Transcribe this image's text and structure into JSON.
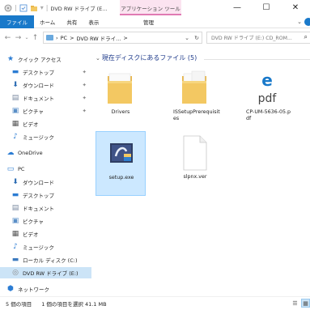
{
  "window": {
    "title": "DVD RW ドライブ (E...",
    "context_tab_group": "アプリケーション ツール",
    "controls": {
      "minimize": "—",
      "maximize": "☐",
      "close": "✕"
    }
  },
  "ribbon": {
    "tabs": [
      "ファイル",
      "ホーム",
      "共有",
      "表示"
    ],
    "context_tab": "管理"
  },
  "address": {
    "back": "←",
    "forward": "→",
    "dropdown": "⌄",
    "up": "↑",
    "segments": [
      "PC",
      ">",
      "DVD RW ドライ...",
      ">"
    ],
    "refresh": "↻",
    "search_placeholder": "DVD RW ドライブ (E:) CD_ROM...",
    "search_icon": "⌕"
  },
  "sidebar": {
    "items": [
      {
        "label": "クイック アクセス",
        "icon": "star-icon",
        "pinned": false
      },
      {
        "label": "デスクトップ",
        "icon": "desktop-icon",
        "pinned": true
      },
      {
        "label": "ダウンロード",
        "icon": "download-icon",
        "pinned": true
      },
      {
        "label": "ドキュメント",
        "icon": "documents-icon",
        "pinned": true
      },
      {
        "label": "ピクチャ",
        "icon": "pictures-icon",
        "pinned": true
      },
      {
        "label": "ビデオ",
        "icon": "videos-icon",
        "pinned": false
      },
      {
        "label": "ミュージック",
        "icon": "music-icon",
        "pinned": false
      },
      {
        "label": "OneDrive",
        "icon": "onedrive-icon",
        "pinned": false
      },
      {
        "label": "PC",
        "icon": "pc-icon",
        "pinned": false
      },
      {
        "label": "ダウンロード",
        "icon": "download-icon",
        "pinned": false
      },
      {
        "label": "デスクトップ",
        "icon": "desktop-icon",
        "pinned": false
      },
      {
        "label": "ドキュメント",
        "icon": "documents-icon",
        "pinned": false
      },
      {
        "label": "ピクチャ",
        "icon": "pictures-icon",
        "pinned": false
      },
      {
        "label": "ビデオ",
        "icon": "videos-icon",
        "pinned": false
      },
      {
        "label": "ミュージック",
        "icon": "music-icon",
        "pinned": false
      },
      {
        "label": "ローカル ディスク (C:)",
        "icon": "local-disk-icon",
        "pinned": false
      },
      {
        "label": "DVD RW ドライブ (E:)",
        "icon": "dvd-drive-icon",
        "pinned": false,
        "selected": true
      },
      {
        "label": "ネットワーク",
        "icon": "network-icon",
        "pinned": false
      }
    ],
    "pin_glyph": "📌"
  },
  "content": {
    "group_header": "現在ディスクにあるファイル (5)",
    "group_chevron": "⌄",
    "files": [
      {
        "name": "Drivers",
        "icon": "folder-icon",
        "selected": false
      },
      {
        "name": "ISSetupPrerequisites",
        "icon": "folder-icon",
        "selected": false
      },
      {
        "name": "CP-UM-5636-05.pdf",
        "icon": "pdf-icon",
        "selected": false
      },
      {
        "name": "setup.exe",
        "icon": "setup-exe-icon",
        "selected": true
      },
      {
        "name": "slpnx.ver",
        "icon": "blank-file-icon",
        "selected": false
      }
    ]
  },
  "status": {
    "item_count": "5 個の項目",
    "selection": "1 個の項目を選択  41.1 MB"
  },
  "colors": {
    "accent": "#1979ca",
    "context_tab": "#fbe3f0",
    "selection": "#cce8ff",
    "folder": "#f3c862"
  }
}
